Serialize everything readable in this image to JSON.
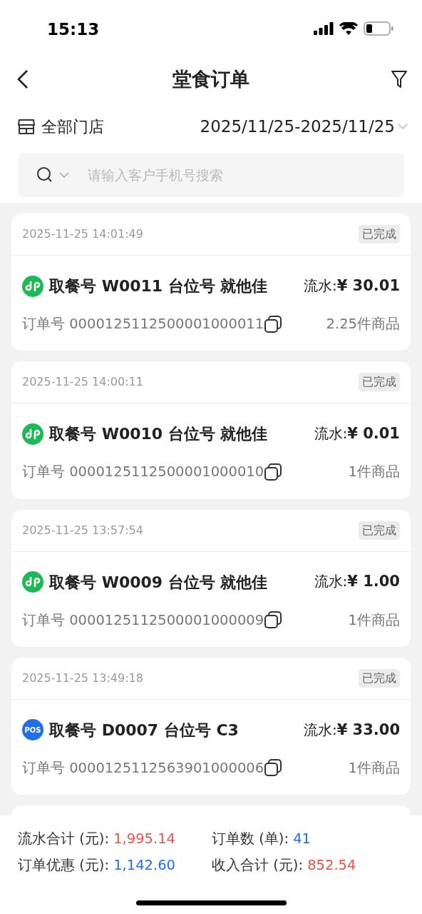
{
  "status_bar": {
    "time": "15:13"
  },
  "header": {
    "title": "堂食订单"
  },
  "filters": {
    "store": "全部门店",
    "date_range": "2025/11/25-2025/11/25"
  },
  "search": {
    "placeholder": "请输入客户手机号搜索"
  },
  "orders": [
    {
      "time": "2025-11-25 14:01:49",
      "status": "已完成",
      "source": {
        "kind": "miniapp"
      },
      "title": "取餐号 W0011 台位号 就他佳",
      "amount_label": "流水:",
      "amount": "¥ 30.01",
      "order_no": "订单号 0000125112500001000011",
      "items": "2.25件商品"
    },
    {
      "time": "2025-11-25 14:00:11",
      "status": "已完成",
      "source": {
        "kind": "miniapp"
      },
      "title": "取餐号 W0010 台位号 就他佳",
      "amount_label": "流水:",
      "amount": "¥ 0.01",
      "order_no": "订单号 0000125112500001000010",
      "items": "1件商品"
    },
    {
      "time": "2025-11-25 13:57:54",
      "status": "已完成",
      "source": {
        "kind": "miniapp"
      },
      "title": "取餐号 W0009 台位号 就他佳",
      "amount_label": "流水:",
      "amount": "¥ 1.00",
      "order_no": "订单号 0000125112500001000009",
      "items": "1件商品"
    },
    {
      "time": "2025-11-25 13:49:18",
      "status": "已完成",
      "source": {
        "kind": "pos",
        "label": "POS"
      },
      "title": "取餐号 D0007 台位号 C3",
      "amount_label": "流水:",
      "amount": "¥ 33.00",
      "order_no": "订单号 0000125112563901000006",
      "items": "1件商品"
    }
  ],
  "summary": [
    {
      "label": "流水合计 (元):",
      "value": "1,995.14",
      "color": "#e5534b"
    },
    {
      "label": "订单数 (单):",
      "value": "41",
      "color": "#1f6fe5"
    },
    {
      "label": "订单优惠 (元):",
      "value": "1,142.60",
      "color": "#1f6fe5"
    },
    {
      "label": "收入合计 (元):",
      "value": "852.54",
      "color": "#e5534b"
    }
  ]
}
